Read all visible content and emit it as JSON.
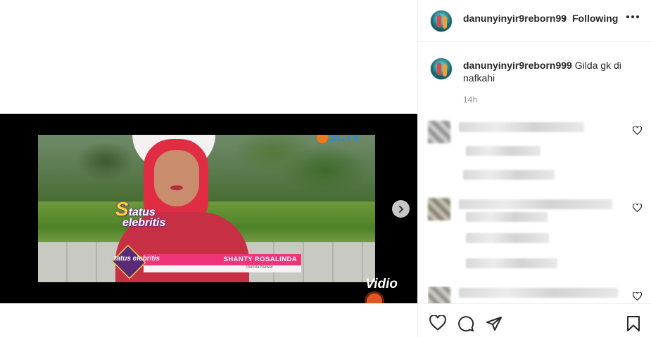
{
  "post": {
    "username": "danunyinyir9reborn99",
    "separator": "•",
    "follow_label": "Following",
    "caption_user": "danunyinyir9reborn999",
    "caption_text": "Gilda gk di nafkahi",
    "time_ago": "14h"
  },
  "video": {
    "channel_logo": "SCTV",
    "show_logo_line1": "tatus",
    "show_logo_line2": "elebritis",
    "badge_text": "tatus elebritis",
    "lower_third_name": "SHANTY ROSALINDA",
    "lower_third_role": "Ibunda Mawar",
    "watermark": "Vidio"
  },
  "icons": {
    "next": "chevron-right-icon",
    "more": "more-horizontal-icon",
    "like": "heart-icon",
    "comment": "comment-icon",
    "share": "send-icon",
    "save": "bookmark-icon"
  },
  "colors": {
    "text": "#262626",
    "muted": "#8e8e8e",
    "border": "#efefef",
    "lower_third": "#f0347a"
  }
}
